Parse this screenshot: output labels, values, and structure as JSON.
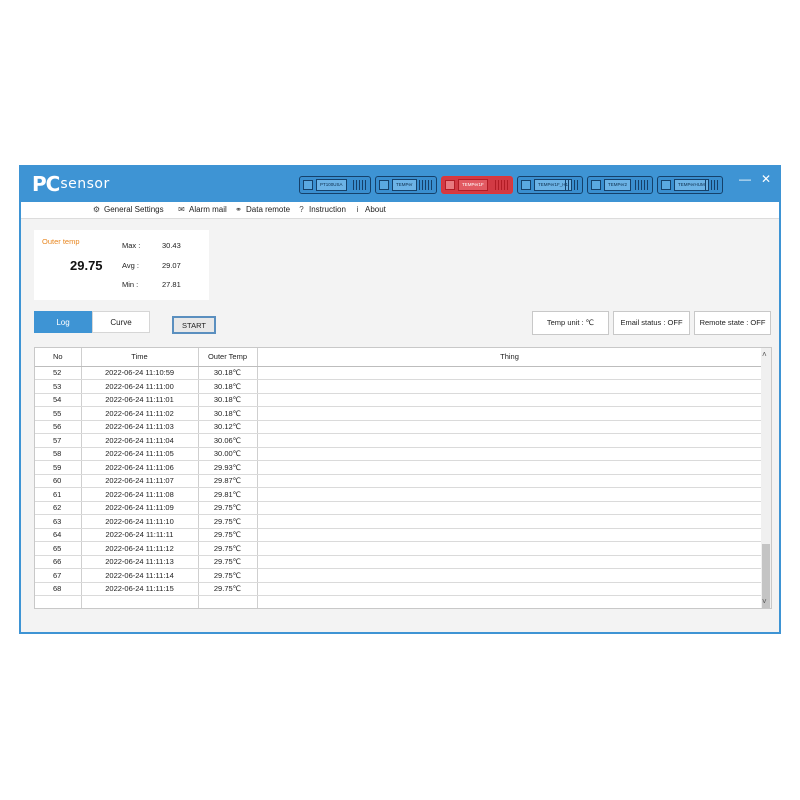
{
  "app": {
    "logo_pc": "PC",
    "logo_sensor": "sensor",
    "devices": [
      {
        "label": "PT100USA",
        "active": false
      },
      {
        "label": "TEMPer",
        "active": false
      },
      {
        "label": "TEMPer1F",
        "active": true
      },
      {
        "label": "TEMPer1F_H1",
        "active": false
      },
      {
        "label": "TEMPer2",
        "active": false
      },
      {
        "label": "TEMPerHUM",
        "active": false
      }
    ],
    "window_controls": {
      "minimize": "—",
      "close": "✕"
    }
  },
  "menu": {
    "general_settings": "General Settings",
    "alarm_mail": "Alarm mail",
    "data_remote": "Data remote",
    "instruction": "Instruction",
    "about": "About"
  },
  "stats": {
    "title": "Outer temp",
    "current": "29.75",
    "max_label": "Max :",
    "max": "30.43",
    "avg_label": "Avg :",
    "avg": "29.07",
    "min_label": "Min :",
    "min": "27.81"
  },
  "tabs": {
    "log": "Log",
    "curve": "Curve",
    "active": "log"
  },
  "start_button": "START",
  "status": {
    "temp_unit": "Temp unit : ℃",
    "email_status": "Email status : OFF",
    "remote_state": "Remote state : OFF"
  },
  "table": {
    "headers": [
      "No",
      "Time",
      "Outer Temp",
      "Thing"
    ],
    "rows": [
      [
        "52",
        "2022-06-24 11:10:59",
        "30.18℃",
        ""
      ],
      [
        "53",
        "2022-06-24 11:11:00",
        "30.18℃",
        ""
      ],
      [
        "54",
        "2022-06-24 11:11:01",
        "30.18℃",
        ""
      ],
      [
        "55",
        "2022-06-24 11:11:02",
        "30.18℃",
        ""
      ],
      [
        "56",
        "2022-06-24 11:11:03",
        "30.12℃",
        ""
      ],
      [
        "57",
        "2022-06-24 11:11:04",
        "30.06℃",
        ""
      ],
      [
        "58",
        "2022-06-24 11:11:05",
        "30.00℃",
        ""
      ],
      [
        "59",
        "2022-06-24 11:11:06",
        "29.93℃",
        ""
      ],
      [
        "60",
        "2022-06-24 11:11:07",
        "29.87℃",
        ""
      ],
      [
        "61",
        "2022-06-24 11:11:08",
        "29.81℃",
        ""
      ],
      [
        "62",
        "2022-06-24 11:11:09",
        "29.75℃",
        ""
      ],
      [
        "63",
        "2022-06-24 11:11:10",
        "29.75℃",
        ""
      ],
      [
        "64",
        "2022-06-24 11:11:11",
        "29.75℃",
        ""
      ],
      [
        "65",
        "2022-06-24 11:11:12",
        "29.75℃",
        ""
      ],
      [
        "66",
        "2022-06-24 11:11:13",
        "29.75℃",
        ""
      ],
      [
        "67",
        "2022-06-24 11:11:14",
        "29.75℃",
        ""
      ],
      [
        "68",
        "2022-06-24 11:11:15",
        "29.75℃",
        ""
      ],
      [
        "",
        "",
        "",
        ""
      ]
    ]
  }
}
